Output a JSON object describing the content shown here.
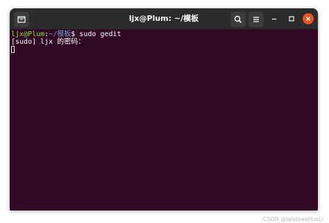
{
  "window": {
    "title": "ljx@Plum: ~/模板"
  },
  "terminal": {
    "prompt_user": "ljx@Plum",
    "prompt_sep": ":",
    "prompt_path": "~/模板",
    "prompt_symbol": "$",
    "command": " sudo gedit",
    "output_line": "[sudo] ljx 的密码："
  },
  "watermark": "CSDN @lalalaaaHuaLi",
  "icons": {
    "new_tab": "new-tab-icon",
    "search": "search-icon",
    "menu": "hamburger-menu-icon",
    "minimize": "minimize-icon",
    "maximize": "maximize-icon",
    "close": "close-icon"
  },
  "colors": {
    "terminal_bg": "#300a24",
    "prompt_user": "#8ae234",
    "prompt_path": "#729fcf",
    "titlebar_bg": "#2c2c2c",
    "close_button": "#e95420"
  }
}
